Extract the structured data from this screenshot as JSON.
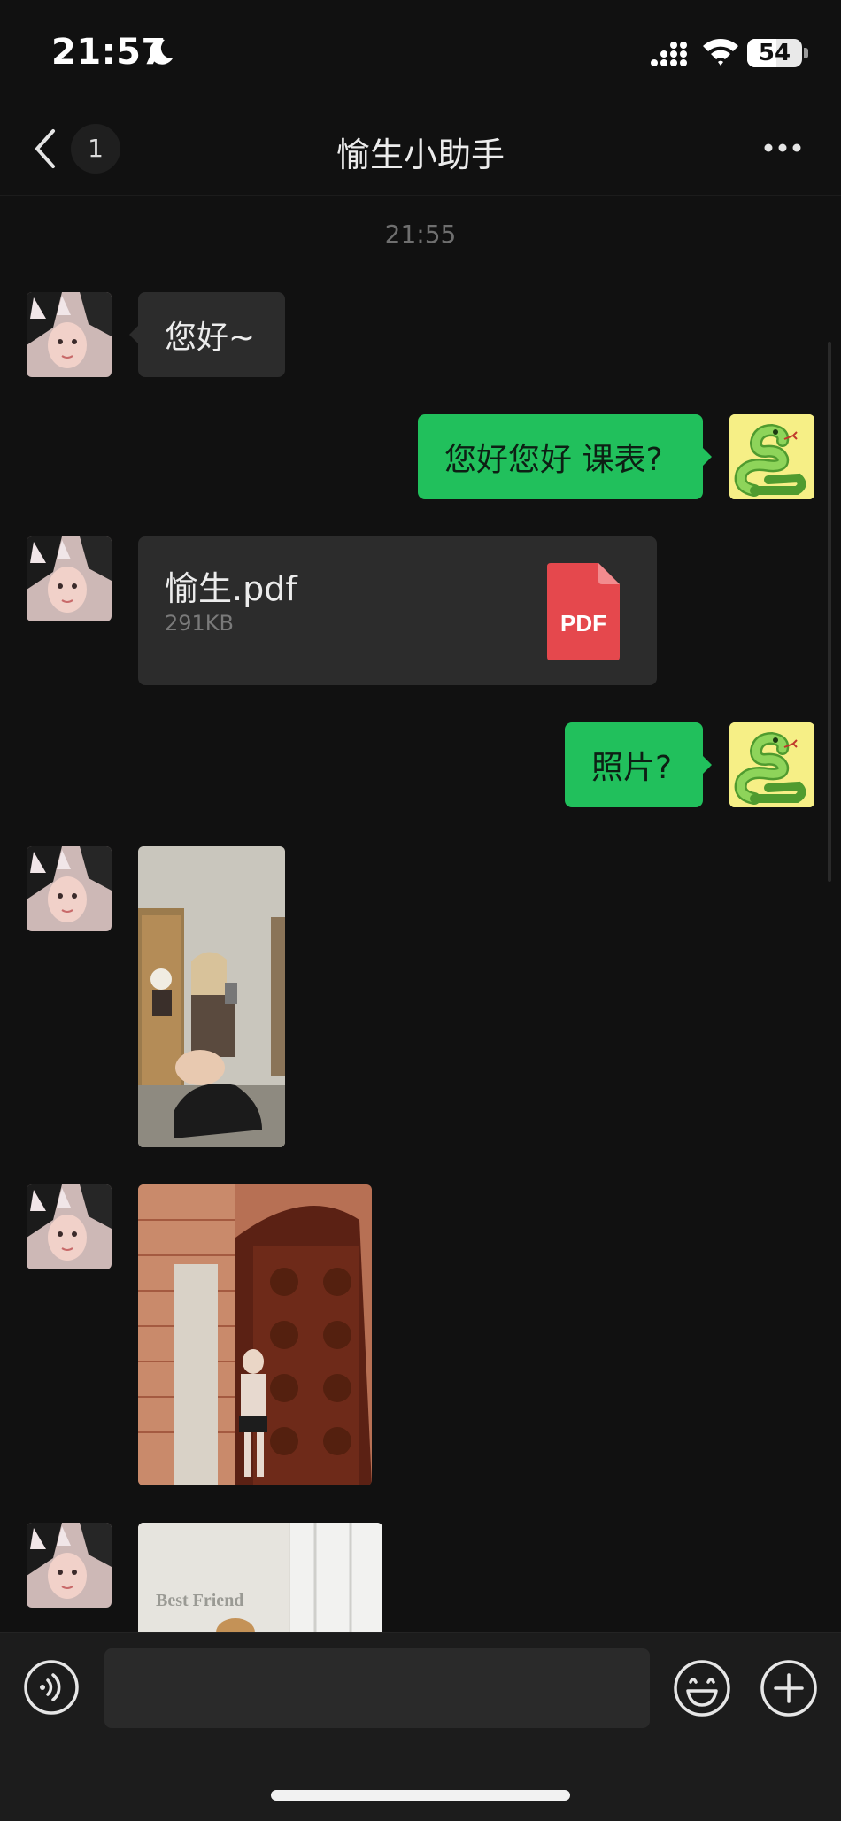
{
  "status_bar": {
    "time": "21:57",
    "battery_level": "54"
  },
  "header": {
    "unread_count": "1",
    "title": "愉生小助手"
  },
  "chat": {
    "timestamp": "21:55",
    "messages": [
      {
        "from": "contact",
        "type": "text",
        "text": "您好~"
      },
      {
        "from": "me",
        "type": "text",
        "text": "您好您好 课表?"
      },
      {
        "from": "contact",
        "type": "file",
        "file_name": "愉生.pdf",
        "file_size": "291KB",
        "file_icon_label": "PDF"
      },
      {
        "from": "me",
        "type": "text",
        "text": "照片?"
      },
      {
        "from": "contact",
        "type": "image"
      },
      {
        "from": "contact",
        "type": "image"
      },
      {
        "from": "contact",
        "type": "image",
        "visible_text": "Best Friend"
      }
    ]
  },
  "input_bar": {
    "placeholder": ""
  },
  "colors": {
    "outgoing_bubble": "#21c05c",
    "incoming_bubble": "#2c2c2c",
    "pdf_red": "#e5484d",
    "background": "#111111"
  },
  "icons": [
    "moon-icon",
    "signal-icon",
    "wifi-icon",
    "battery-icon",
    "back-chevron-icon",
    "more-dots-icon",
    "pdf-file-icon",
    "voice-icon",
    "emoji-icon",
    "plus-icon"
  ]
}
